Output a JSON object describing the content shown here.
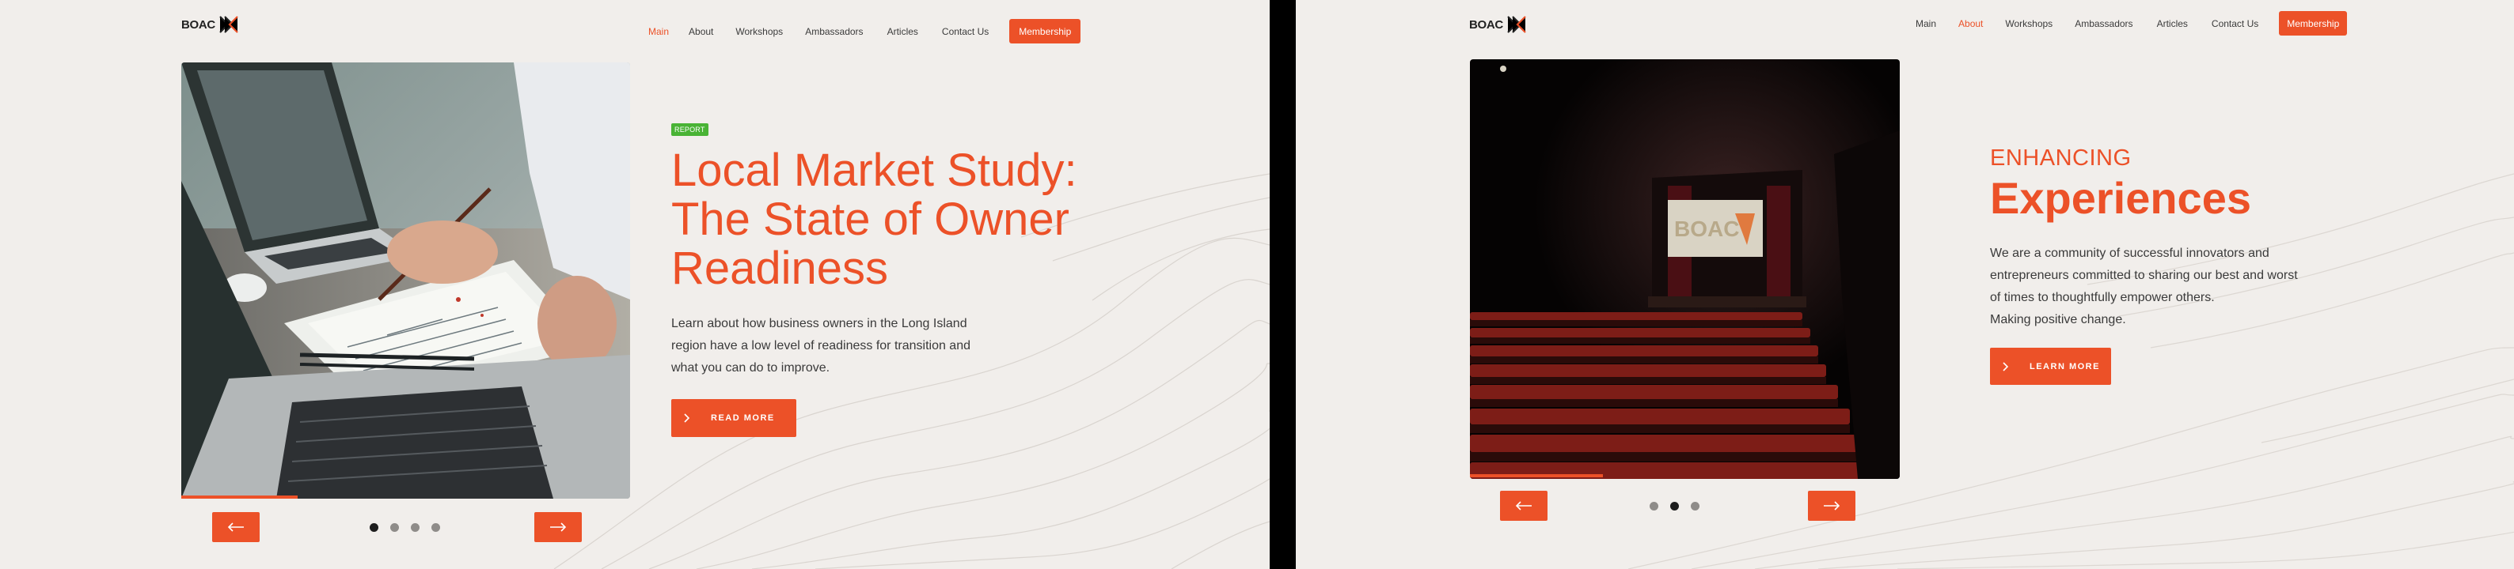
{
  "brand": {
    "logo_text": "BOAC",
    "accent": "#ec5128",
    "badge_green": "#49b335",
    "background": "#f1eeeb"
  },
  "membership_label": "Membership",
  "slide1": {
    "nav": [
      {
        "label": "Main",
        "active": true
      },
      {
        "label": "About",
        "active": false
      },
      {
        "label": "Workshops",
        "active": false
      },
      {
        "label": "Ambassadors",
        "active": false
      },
      {
        "label": "Articles",
        "active": false
      },
      {
        "label": "Contact Us",
        "active": false
      }
    ],
    "badge": "REPORT",
    "title_lines": [
      "Local Market Study:",
      "The State of Owner",
      "Readiness"
    ],
    "body_lines": [
      "Learn about how business owners in the Long Island",
      "region have a low level of readiness for transition and",
      "what you can do to improve."
    ],
    "cta_label": "READ MORE",
    "cta_icon": "chevron-right-icon",
    "image_alt": "laptops-and-documents-photo",
    "dots": {
      "count": 4,
      "active_index": 0
    },
    "progress": 0.26
  },
  "slide2": {
    "nav": [
      {
        "label": "Main",
        "active": false
      },
      {
        "label": "About",
        "active": true
      },
      {
        "label": "Workshops",
        "active": false
      },
      {
        "label": "Ambassadors",
        "active": false
      },
      {
        "label": "Articles",
        "active": false
      },
      {
        "label": "Contact Us",
        "active": false
      }
    ],
    "eyebrow": "ENHANCING",
    "title": "Experiences",
    "body_lines": [
      "We are a community of successful innovators and",
      "entrepreneurs committed to sharing our best and worst",
      "of times to thoughtfully empower others.",
      "Making positive change."
    ],
    "cta_label": "LEARN MORE",
    "cta_icon": "chevron-right-icon",
    "image_alt": "theater-auditorium-photo",
    "screen_text": "BOAC",
    "dots": {
      "count": 3,
      "active_index": 1
    },
    "progress": 0.31
  }
}
